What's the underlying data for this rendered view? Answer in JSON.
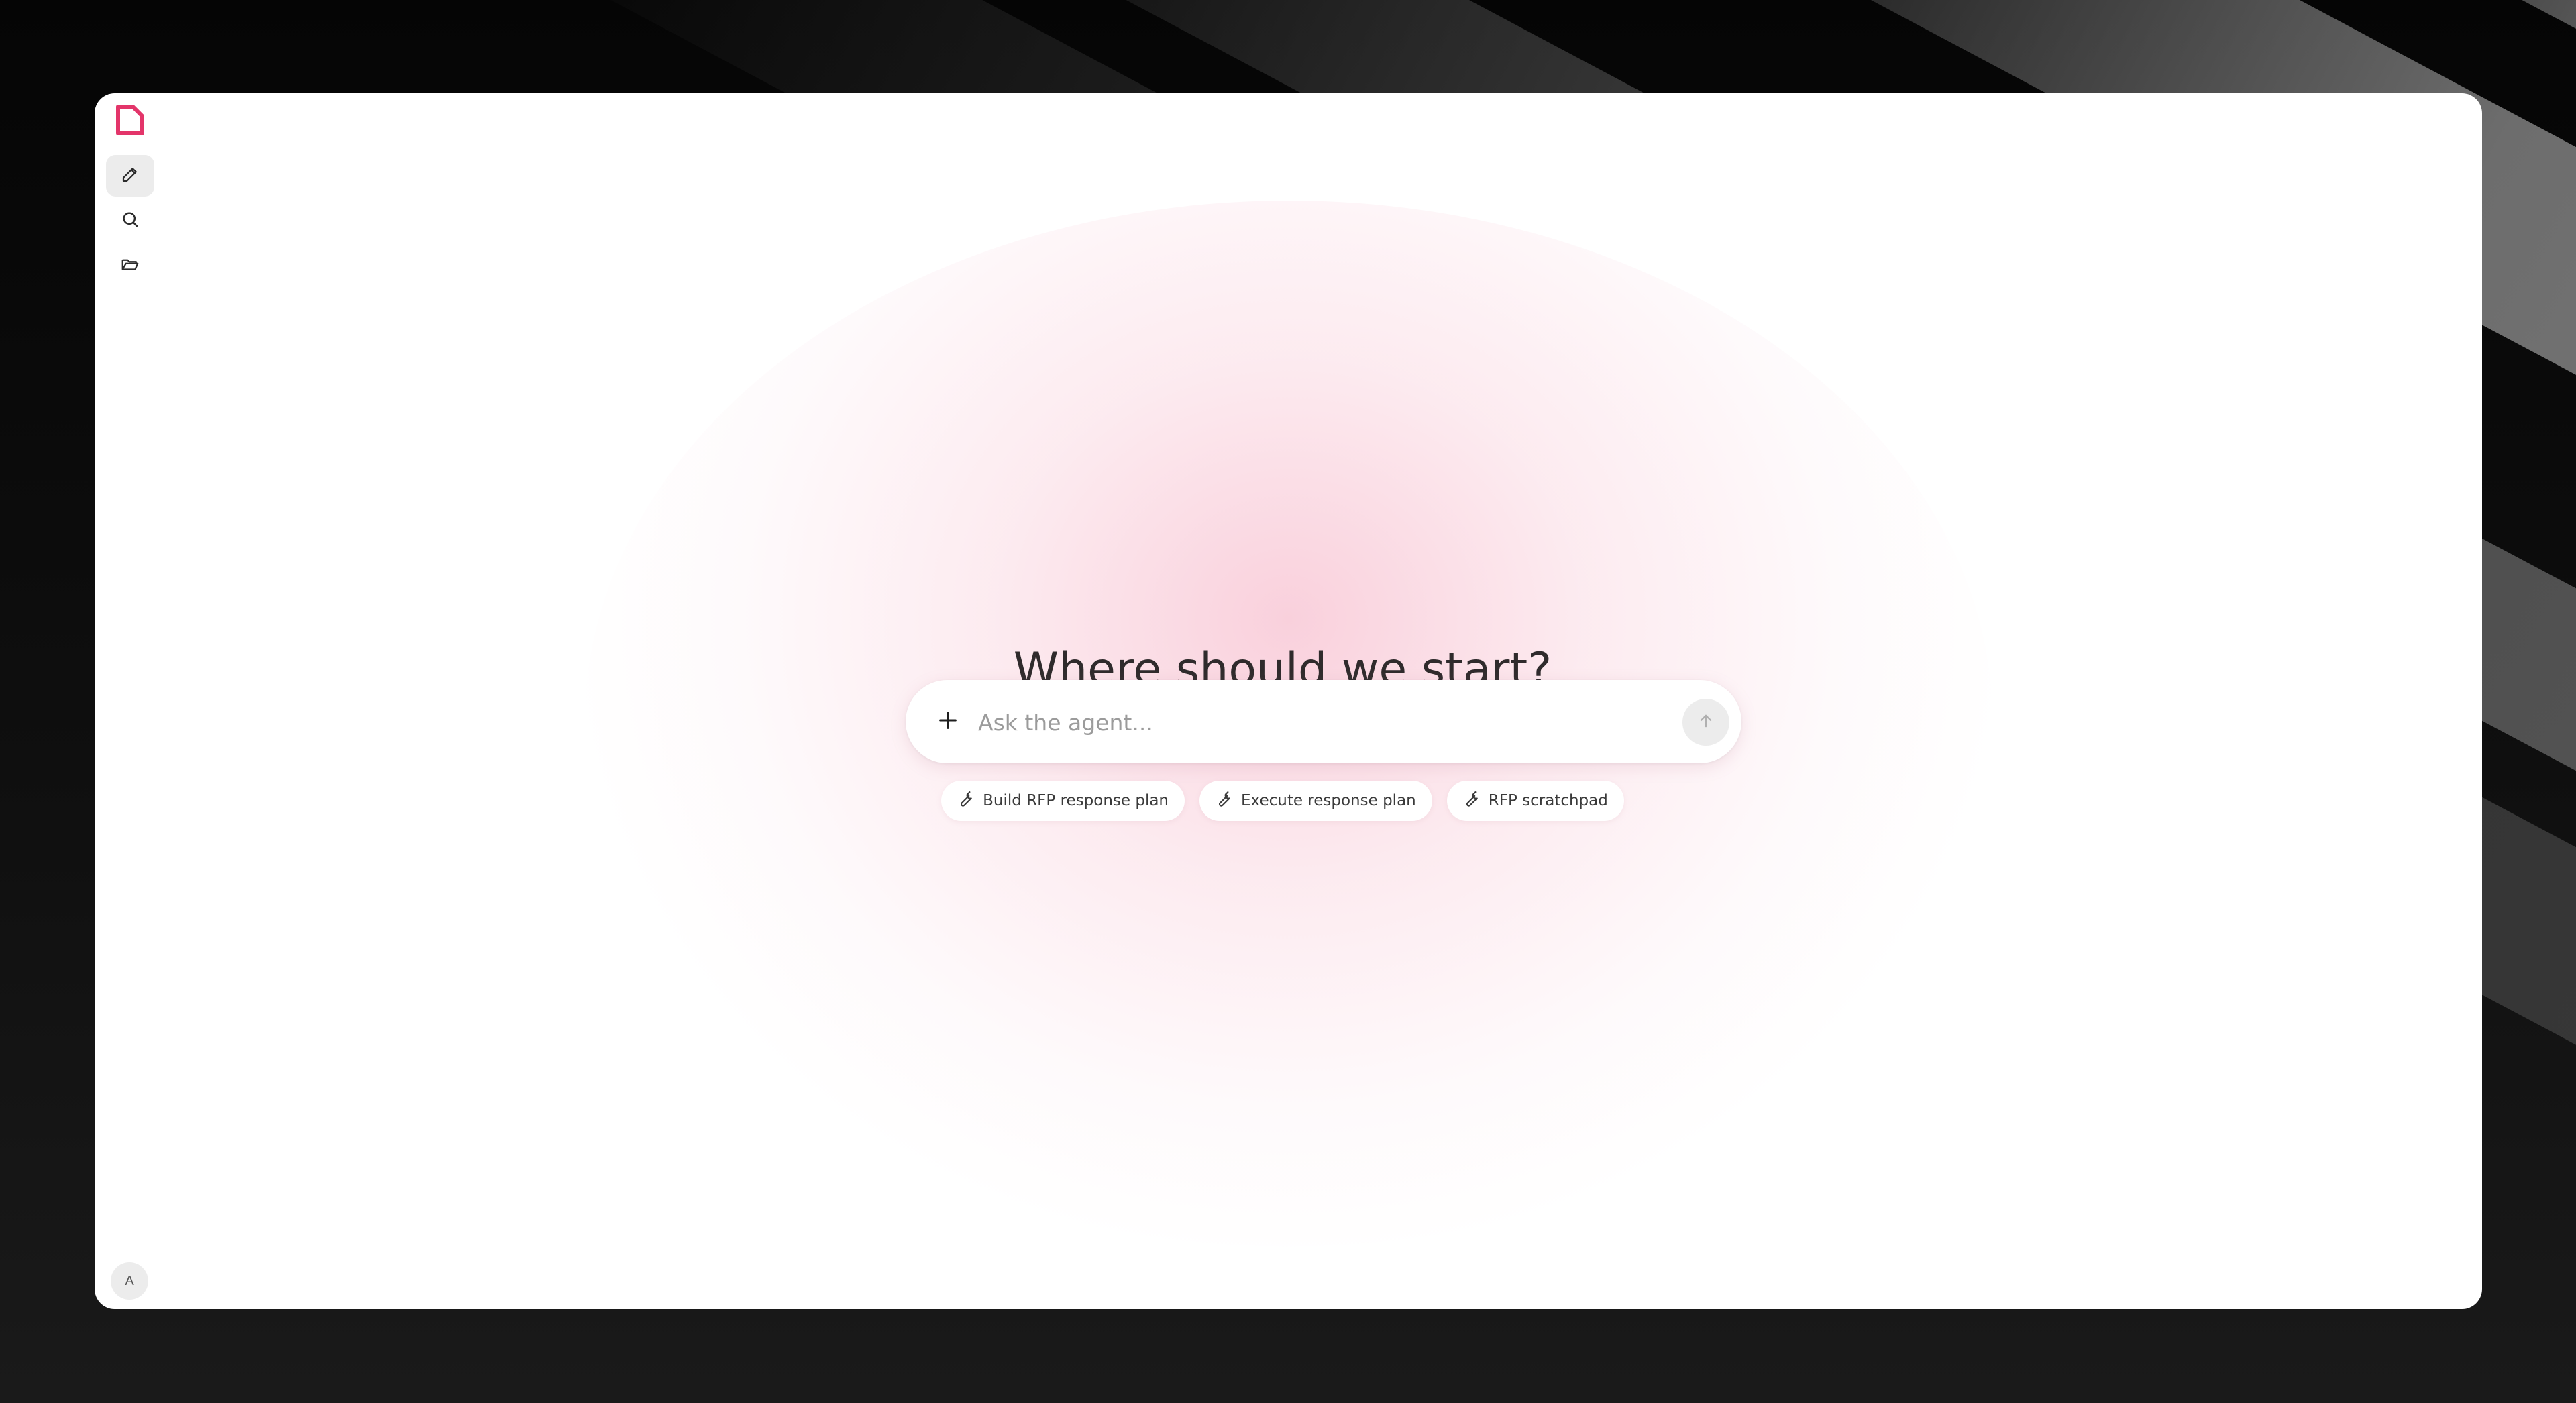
{
  "app": {
    "heading": "Where should we start?",
    "accent_color": "#e3356a"
  },
  "sidebar": {
    "logo_icon": "document-logo-icon",
    "items": [
      {
        "name": "new-chat",
        "icon": "pencil-icon",
        "active": true
      },
      {
        "name": "search",
        "icon": "search-icon",
        "active": false
      },
      {
        "name": "projects",
        "icon": "folder-open-icon",
        "active": false
      }
    ],
    "avatar_initial": "A"
  },
  "prompt": {
    "placeholder": "Ask the agent...",
    "value": "",
    "attach_icon": "plus-icon",
    "send_icon": "arrow-up-icon"
  },
  "suggestions": [
    {
      "label": "Build RFP response plan",
      "icon": "wrench-icon"
    },
    {
      "label": "Execute response plan",
      "icon": "wrench-icon"
    },
    {
      "label": "RFP scratchpad",
      "icon": "wrench-icon"
    }
  ]
}
